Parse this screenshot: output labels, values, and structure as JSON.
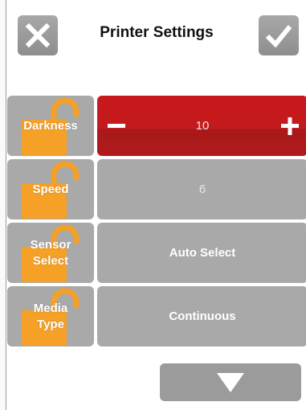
{
  "header": {
    "title": "Printer Settings",
    "close_icon": "close-icon",
    "confirm_icon": "checkmark-icon"
  },
  "settings": [
    {
      "label": "Darkness",
      "value": "10",
      "active": true
    },
    {
      "label": "Speed",
      "value": "6",
      "active": false
    },
    {
      "label": "Sensor Select",
      "value": "Auto Select",
      "active": false
    },
    {
      "label": "Media Type",
      "value": "Continuous",
      "active": false
    }
  ],
  "stepper": {
    "decrement_icon": "minus-icon",
    "increment_icon": "plus-icon"
  },
  "footer": {
    "next_icon": "down-arrow-icon"
  },
  "colors": {
    "tile": "#a9a9a9",
    "active": "#c41a1d",
    "lock": "#f5a027"
  }
}
